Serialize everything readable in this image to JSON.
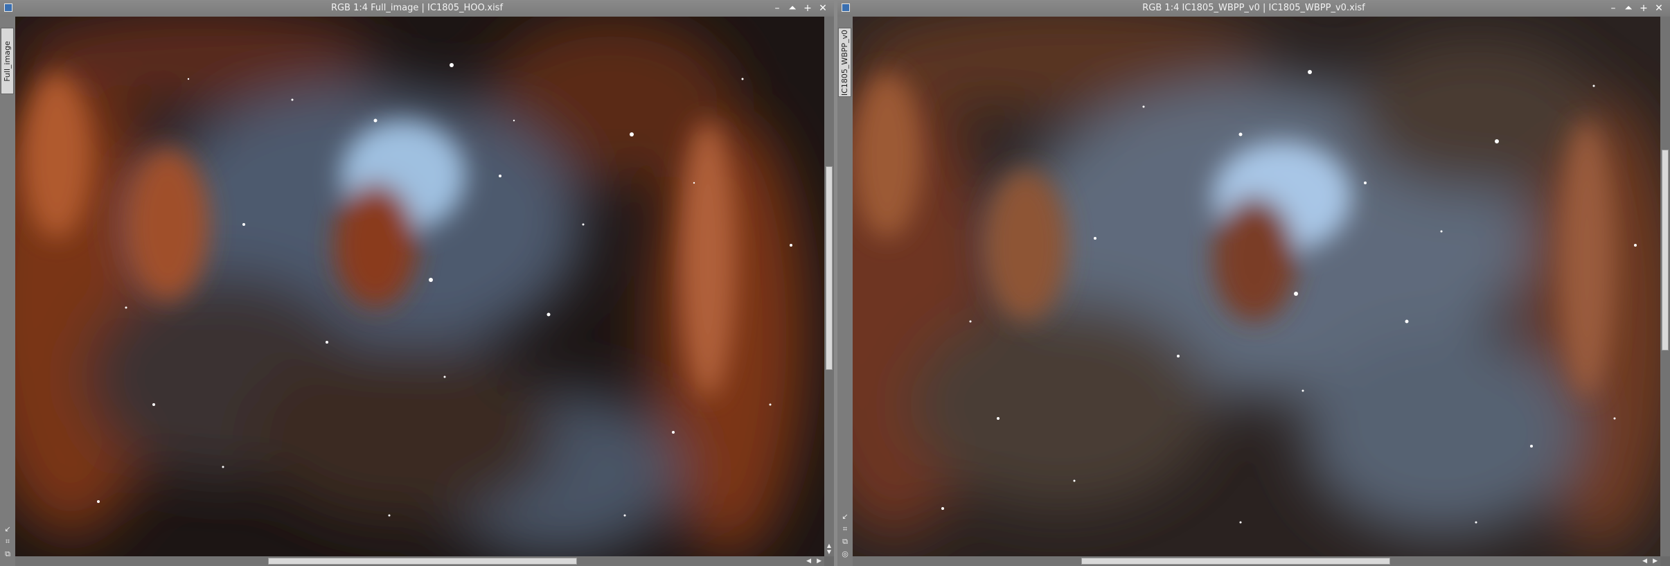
{
  "windows": [
    {
      "title": "RGB 1:4 Full_image | IC1805_HOO.xisf",
      "side_tab": "Full_image",
      "buttons": {
        "minimize": "–",
        "shade": "⏶",
        "maximize": "+",
        "close": "✕"
      }
    },
    {
      "title": "RGB 1:4 IC1805_WBPP_v0 | IC1805_WBPP_v0.xisf",
      "side_tab": "IC1805_WBPP_v0",
      "buttons": {
        "minimize": "–",
        "shade": "⏶",
        "maximize": "+",
        "close": "✕"
      }
    }
  ],
  "side_icons": [
    "↙",
    "⌗",
    "⧉"
  ],
  "side_icons2": [
    "↙",
    "⌗",
    "⧉",
    "◎"
  ],
  "scroll_arrows": {
    "up": "▲",
    "down": "▼",
    "left": "◀",
    "right": "▶"
  },
  "colors": {
    "titlebar": "#808080",
    "nebula_red": "#8c3a1c",
    "nebula_blue": "#8fb1d6",
    "space": "#1a1413"
  }
}
